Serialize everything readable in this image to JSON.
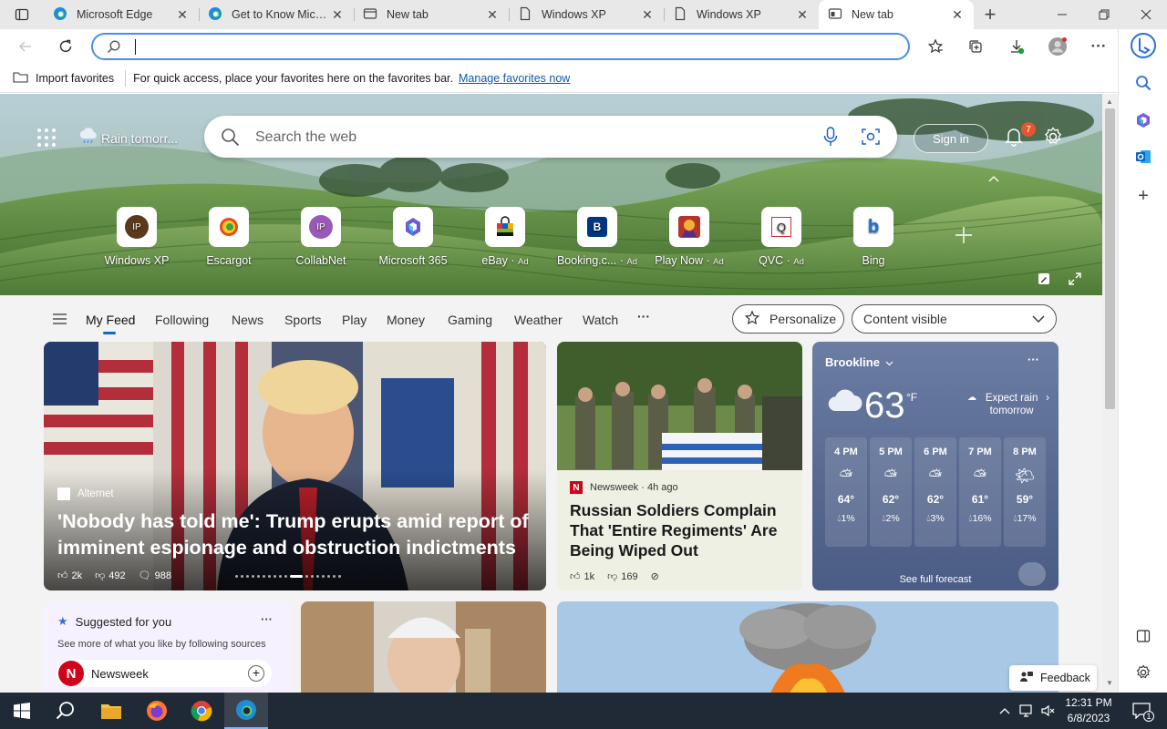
{
  "tabs": [
    {
      "label": "Microsoft Edge",
      "icon": "edge-icon"
    },
    {
      "label": "Get to Know Micros",
      "icon": "edge-icon"
    },
    {
      "label": "New tab",
      "icon": "page-icon"
    },
    {
      "label": "Windows XP",
      "icon": "page-icon"
    },
    {
      "label": "Windows XP",
      "icon": "page-icon"
    },
    {
      "label": "New tab",
      "icon": "newtab-icon",
      "active": true
    }
  ],
  "address": {
    "value": "",
    "placeholder": ""
  },
  "favbar": {
    "import_label": "Import favorites",
    "hint": "For quick access, place your favorites here on the favorites bar.",
    "manage_link": "Manage favorites now"
  },
  "hero": {
    "weather_label": "Rain tomorr...",
    "search_placeholder": "Search the web",
    "signin_label": "Sign in",
    "notif_count": "7",
    "quicklinks": [
      {
        "label": "Windows XP",
        "ad": "",
        "icon_text": "IP",
        "icon_bg": "#5a3a1a"
      },
      {
        "label": "Escargot",
        "ad": "",
        "icon_text": "",
        "icon_bg": "#fff"
      },
      {
        "label": "CollabNet",
        "ad": "",
        "icon_text": "IP",
        "icon_bg": "#9b59b6"
      },
      {
        "label": "Microsoft 365",
        "ad": "",
        "icon_text": "",
        "icon_bg": "#fff"
      },
      {
        "label": "eBay",
        "ad": "Ad",
        "icon_text": "",
        "icon_bg": "#fff"
      },
      {
        "label": "Booking.c...",
        "ad": "Ad",
        "icon_text": "B",
        "icon_bg": "#003580"
      },
      {
        "label": "Play Now",
        "ad": "Ad",
        "icon_text": "",
        "icon_bg": "#fff"
      },
      {
        "label": "QVC",
        "ad": "Ad",
        "icon_text": "Q",
        "icon_bg": "#fff"
      },
      {
        "label": "Bing",
        "ad": "",
        "icon_text": "b",
        "icon_bg": "#fff"
      }
    ]
  },
  "feednav": {
    "items": [
      "My Feed",
      "Following",
      "News",
      "Sports",
      "Play",
      "Money",
      "Gaming",
      "Weather",
      "Watch"
    ],
    "more": "···",
    "personalize": "Personalize",
    "content_visible": "Content visible"
  },
  "main_story": {
    "source": "Alternet",
    "headline": "'Nobody has told me': Trump erupts amid report of imminent espionage and obstruction indictments",
    "likes": "2k",
    "dislikes": "492",
    "comments": "988"
  },
  "story2": {
    "source": "Newsweek · 4h ago",
    "headline": "Russian Soldiers Complain That 'Entire Regiments' Are Being Wiped Out",
    "likes": "1k",
    "dislikes": "169"
  },
  "weather": {
    "location": "Brookline",
    "temp": "63",
    "unit": "°F",
    "note": "Expect rain tomorrow",
    "hours": [
      {
        "time": "4 PM",
        "temp": "64°",
        "precip": "1%"
      },
      {
        "time": "5 PM",
        "temp": "62°",
        "precip": "2%"
      },
      {
        "time": "6 PM",
        "temp": "62°",
        "precip": "3%"
      },
      {
        "time": "7 PM",
        "temp": "61°",
        "precip": "16%"
      },
      {
        "time": "8 PM",
        "temp": "59°",
        "precip": "17%"
      }
    ],
    "forecast_link": "See full forecast"
  },
  "suggested": {
    "title": "Suggested for you",
    "desc": "See more of what you like by following sources",
    "source": "Newsweek"
  },
  "feedback": "Feedback",
  "taskbar": {
    "time": "12:31 PM",
    "date": "6/8/2023",
    "notif": "1"
  }
}
